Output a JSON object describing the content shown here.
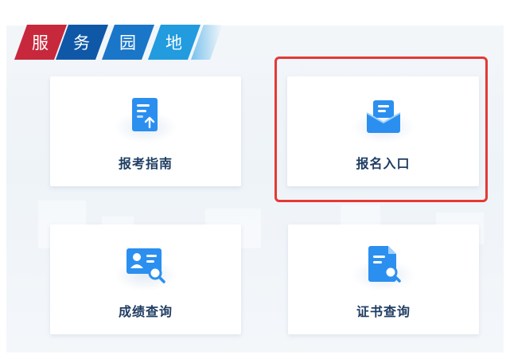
{
  "banner": {
    "chars": [
      "服",
      "务",
      "园",
      "地"
    ],
    "colors": [
      "#c8283c",
      "#0f58a8",
      "#1a76c8",
      "#229bdf"
    ]
  },
  "cards": [
    {
      "label": "报考指南",
      "icon": "document-upload-icon"
    },
    {
      "label": "报名入口",
      "icon": "envelope-icon"
    },
    {
      "label": "成绩查询",
      "icon": "id-card-search-icon"
    },
    {
      "label": "证书查询",
      "icon": "document-search-icon"
    }
  ],
  "highlight_color": "#e53935",
  "icon_color": "#2b8ff0",
  "label_color": "#1f3d63"
}
